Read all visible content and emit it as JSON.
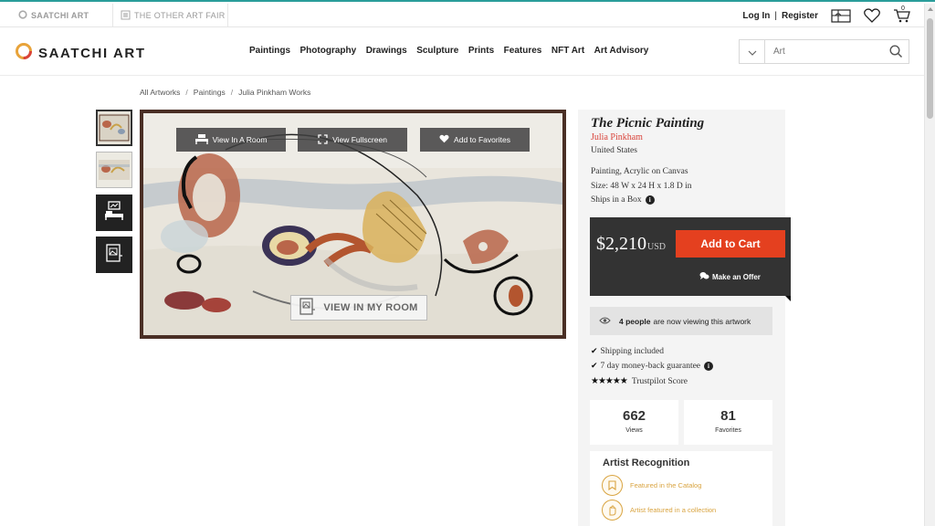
{
  "utilbar": {
    "tabs": [
      {
        "label": "SAATCHI ART",
        "icon": "saatchi-circle-icon"
      },
      {
        "label": "THE OTHER ART FAIR",
        "icon": "other-art-fair-icon"
      }
    ],
    "login": "Log In",
    "divider": "|",
    "register": "Register",
    "cart_count": "0"
  },
  "header": {
    "logo_text": "SAATCHI ART",
    "nav": [
      "Paintings",
      "Photography",
      "Drawings",
      "Sculpture",
      "Prints",
      "Features",
      "NFT Art",
      "Art Advisory"
    ],
    "search": {
      "placeholder": "Art"
    }
  },
  "breadcrumb": [
    "All Artworks",
    "Paintings",
    "Julia Pinkham Works"
  ],
  "viewer": {
    "buttons": [
      {
        "label": "View In A Room",
        "icon": "bed-icon"
      },
      {
        "label": "View Fullscreen",
        "icon": "fullscreen-icon"
      },
      {
        "label": "Add to Favorites",
        "icon": "heart-icon"
      }
    ],
    "room_button": "VIEW IN MY ROOM"
  },
  "artwork": {
    "title": "The Picnic Painting",
    "artist": "Julia Pinkham",
    "country": "United States",
    "medium": "Painting, Acrylic on Canvas",
    "size": "Size: 48 W x 24 H x 1.8 D in",
    "shipping": "Ships in a Box"
  },
  "purchase": {
    "price": "$2,210",
    "currency": "USD",
    "add_to_cart": "Add to Cart",
    "make_offer": "Make an Offer"
  },
  "viewing": {
    "count": "4 people",
    "text": "are now viewing this artwork"
  },
  "benefits": [
    "Shipping included",
    "7 day money-back guarantee",
    "Trustpilot Score"
  ],
  "stats": [
    {
      "value": "662",
      "label": "Views"
    },
    {
      "value": "81",
      "label": "Favorites"
    }
  ],
  "recognition": {
    "heading": "Artist Recognition",
    "items": [
      "Featured in the Catalog",
      "Artist featured in a collection"
    ]
  },
  "colors": {
    "accent": "#e4401f",
    "artist": "#d9433a",
    "recognition": "#d9a441"
  }
}
